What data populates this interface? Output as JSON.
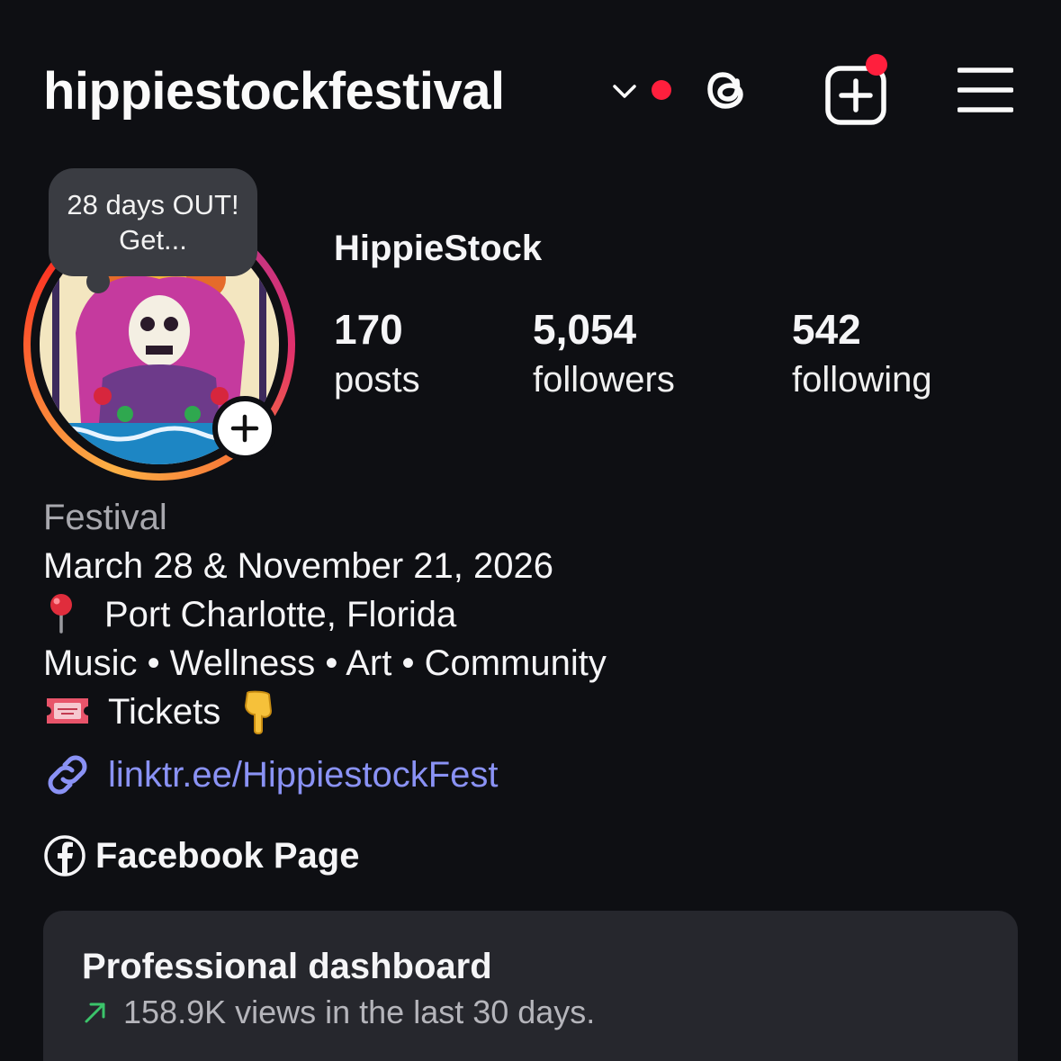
{
  "header": {
    "username": "hippiestockfestival",
    "icons": [
      "chevron-down-icon",
      "threads-icon",
      "add-content-icon",
      "menu-icon"
    ],
    "notification_color": "#ff1f3d"
  },
  "note": {
    "text": "28 days OUT! Get..."
  },
  "profile": {
    "display_name": "HippieStock",
    "stats": {
      "posts": {
        "value": "170",
        "label": "posts"
      },
      "followers": {
        "value": "5,054",
        "label": "followers"
      },
      "following": {
        "value": "542",
        "label": "following"
      }
    }
  },
  "bio": {
    "category": "Festival",
    "dates": "March 28 & November 21, 2026",
    "location": "Port Charlotte, Florida",
    "tags": "Music • Wellness • Art • Community",
    "tickets": "Tickets",
    "link": "linktr.ee/HippiestockFest",
    "link_color": "#8a92f5"
  },
  "facebook": {
    "label": "Facebook Page"
  },
  "dashboard": {
    "title": "Professional dashboard",
    "subtitle": "158.9K views in the last 30 days.",
    "trend_color": "#3bc46a"
  }
}
